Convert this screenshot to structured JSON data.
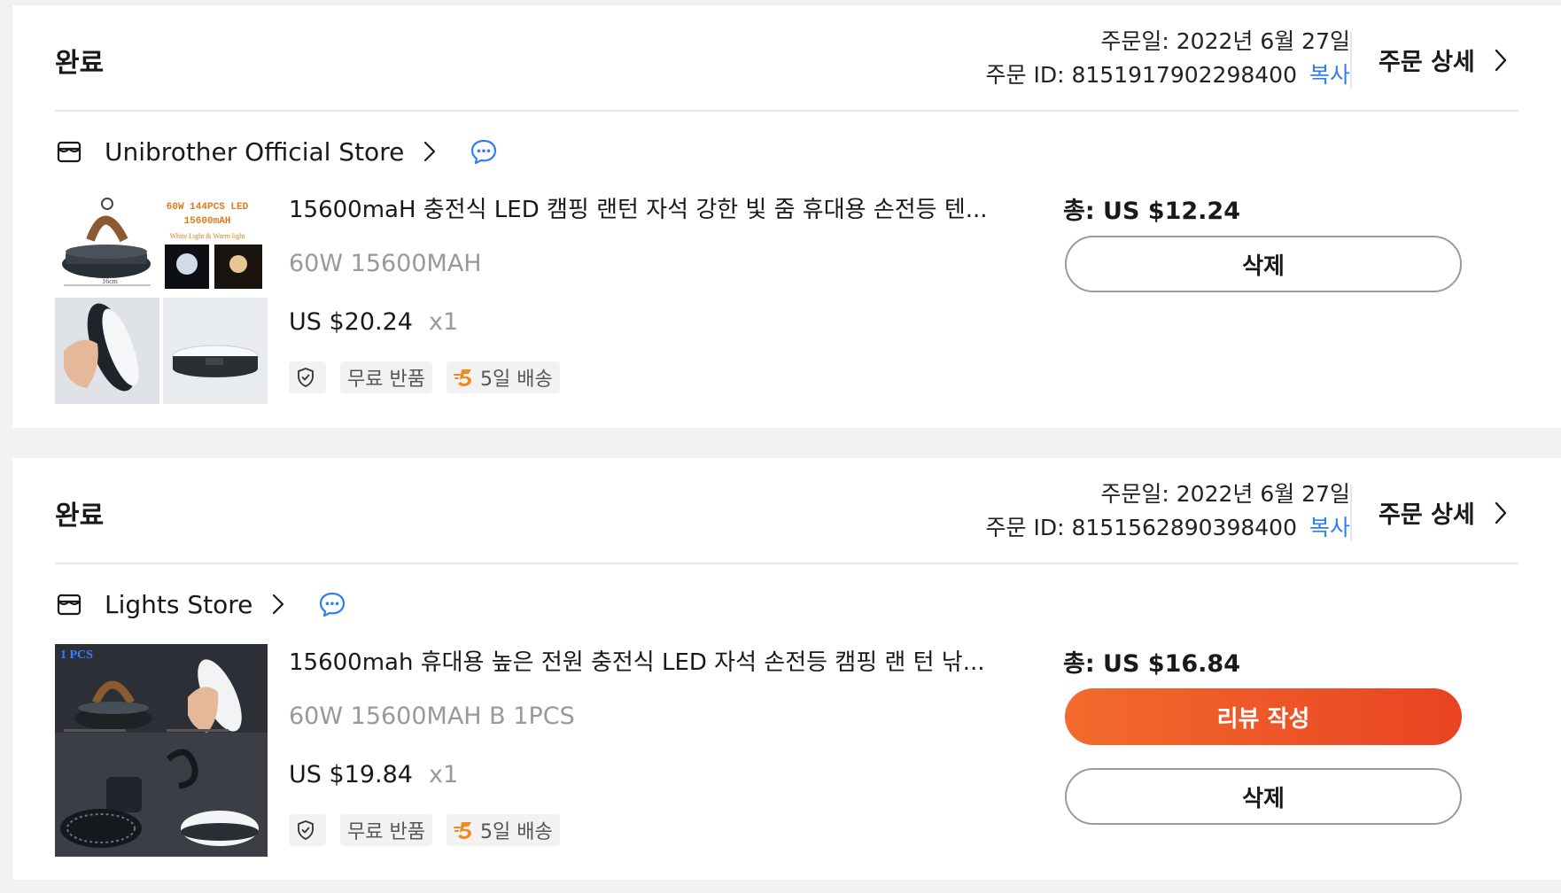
{
  "orders": [
    {
      "status": "완료",
      "order_date": "주문일: 2022년 6월 27일",
      "order_id": "주문 ID: 8151917902298400",
      "copy_label": "복사",
      "detail_label": "주문 상세",
      "store_name": "Unibrother Official Store",
      "product_title": "15600maH 충전식 LED 캠핑 랜턴 자석 강한 빛 줌 휴대용 손전등 텐...",
      "variant": "60W 15600MAH",
      "price": "US $20.24",
      "quantity": "x1",
      "badge_return": "무료 반품",
      "badge_delivery": "5일 배송",
      "total": "총: US $12.24",
      "delete_label": "삭제",
      "thumb_text": [
        "60W 144PCS LED",
        "15600mAH",
        "White Light & Warm light",
        "16cm"
      ]
    },
    {
      "status": "완료",
      "order_date": "주문일: 2022년 6월 27일",
      "order_id": "주문 ID: 8151562890398400",
      "copy_label": "복사",
      "detail_label": "주문 상세",
      "store_name": "Lights Store",
      "product_title": "15600mah 휴대용 높은 전원 충전식 LED 자석 손전등 캠핑 랜 턴 낚...",
      "variant": "60W 15600MAH B 1PCS",
      "price": "US $19.84",
      "quantity": "x1",
      "badge_return": "무료 반품",
      "badge_delivery": "5일 배송",
      "total": "총: US $16.84",
      "review_label": "리뷰 작성",
      "delete_label": "삭제",
      "thumb_text": [
        "1 PCS"
      ]
    }
  ],
  "colors": {
    "accent_link": "#2e7df6",
    "review_button_start": "#f26b2d",
    "review_button_end": "#e94322",
    "page_background": "#f2f2f2"
  },
  "icons": {
    "store": "store-icon",
    "chevron": "chevron-right-icon",
    "chat": "chat-bubble-icon",
    "shield": "shield-check-icon",
    "delivery": "fast-delivery-icon"
  }
}
